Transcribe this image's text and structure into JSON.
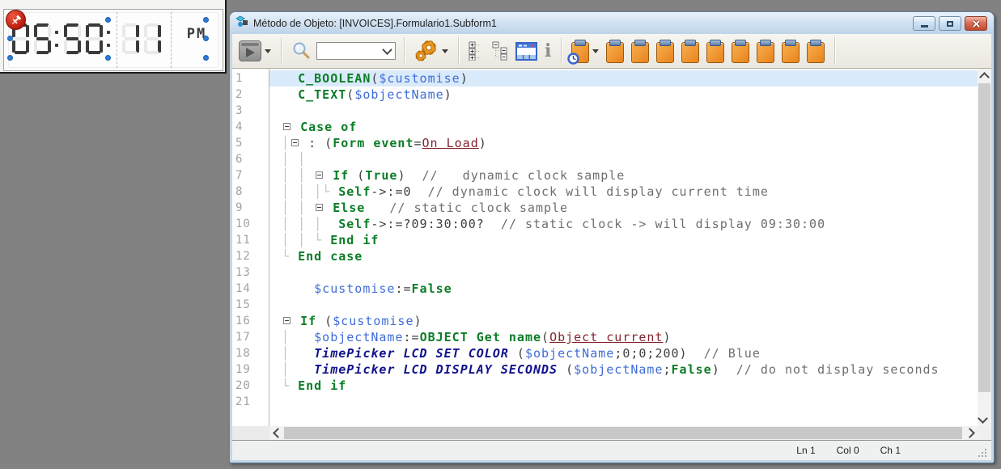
{
  "window": {
    "title": "Método de Objeto: [INVOICES].Formulario1.Subform1"
  },
  "clock": {
    "time_display": "05:50:11",
    "hours": "05",
    "minutes": "50",
    "seconds": "11",
    "period": "PM"
  },
  "toolbar": {
    "search_value": "",
    "icons": [
      "run-method-icon",
      "magnifier-icon",
      "gears-icon",
      "expand-all-icon",
      "collapse-all-icon",
      "form-objects-icon",
      "info-icon",
      "clipboard-clock-icon",
      "clipboard-icon"
    ]
  },
  "status": {
    "line": "Ln 1",
    "column": "Col 0",
    "char": "Ch 1"
  },
  "colors": {
    "keyword_green": "#0b7d26",
    "variable_blue": "#3e6cd8",
    "constant_maroon": "#84242e",
    "plugin_navy": "#10128c",
    "comment_gray": "#6e6e6e",
    "current_line": "#d9eafb",
    "clipboard_orange": "#ef8f2a",
    "lcd_lit": "#3a3a3a",
    "lcd_ghost": "#e9e9e9"
  },
  "editor": {
    "lines": [
      {
        "n": 1,
        "cur": true,
        "t": [
          [
            "o",
            "   "
          ],
          [
            "k",
            "C_BOOLEAN"
          ],
          [
            "o",
            "("
          ],
          [
            "v",
            "$customise"
          ],
          [
            "o",
            ")"
          ]
        ]
      },
      {
        "n": 2,
        "t": [
          [
            "o",
            "   "
          ],
          [
            "k",
            "C_TEXT"
          ],
          [
            "o",
            "("
          ],
          [
            "v",
            "$objectName"
          ],
          [
            "o",
            ")"
          ]
        ]
      },
      {
        "n": 3,
        "t": []
      },
      {
        "n": 4,
        "t": [
          [
            "o",
            " "
          ],
          [
            "f",
            ""
          ],
          [
            "o",
            " "
          ],
          [
            "k",
            "Case of"
          ]
        ]
      },
      {
        "n": 5,
        "t": [
          [
            "o",
            " "
          ],
          [
            "g",
            "│"
          ],
          [
            "f",
            ""
          ],
          [
            "o",
            " "
          ],
          [
            "o",
            ": ("
          ],
          [
            "k",
            "Form event"
          ],
          [
            "o",
            "="
          ],
          [
            "c",
            "On Load"
          ],
          [
            "o",
            ")"
          ]
        ]
      },
      {
        "n": 6,
        "t": [
          [
            "o",
            " "
          ],
          [
            "g",
            "│"
          ],
          [
            "o",
            " "
          ],
          [
            "g",
            "│"
          ]
        ]
      },
      {
        "n": 7,
        "t": [
          [
            "o",
            " "
          ],
          [
            "g",
            "│"
          ],
          [
            "o",
            " "
          ],
          [
            "g",
            "│"
          ],
          [
            "o",
            " "
          ],
          [
            "f",
            ""
          ],
          [
            "o",
            " "
          ],
          [
            "k",
            "If"
          ],
          [
            "o",
            " ("
          ],
          [
            "k",
            "True"
          ],
          [
            "o",
            ")"
          ],
          [
            "m",
            "  //   dynamic clock sample"
          ]
        ]
      },
      {
        "n": 8,
        "t": [
          [
            "o",
            " "
          ],
          [
            "g",
            "│"
          ],
          [
            "o",
            " "
          ],
          [
            "g",
            "│"
          ],
          [
            "o",
            " "
          ],
          [
            "g",
            "│"
          ],
          [
            "g",
            "└"
          ],
          [
            "o",
            " "
          ],
          [
            "k",
            "Self"
          ],
          [
            "o",
            "->:=0"
          ],
          [
            "m",
            "  // dynamic clock will display current time"
          ]
        ]
      },
      {
        "n": 9,
        "t": [
          [
            "o",
            " "
          ],
          [
            "g",
            "│"
          ],
          [
            "o",
            " "
          ],
          [
            "g",
            "│"
          ],
          [
            "o",
            " "
          ],
          [
            "f",
            ""
          ],
          [
            "o",
            " "
          ],
          [
            "k",
            "Else"
          ],
          [
            "m",
            "   // static clock sample"
          ]
        ]
      },
      {
        "n": 10,
        "t": [
          [
            "o",
            " "
          ],
          [
            "g",
            "│"
          ],
          [
            "o",
            " "
          ],
          [
            "g",
            "│"
          ],
          [
            "o",
            " "
          ],
          [
            "g",
            "│"
          ],
          [
            "o",
            "  "
          ],
          [
            "k",
            "Self"
          ],
          [
            "o",
            "->:=?09:30:00?"
          ],
          [
            "m",
            "  // static clock -> will display 09:30:00"
          ]
        ]
      },
      {
        "n": 11,
        "t": [
          [
            "o",
            " "
          ],
          [
            "g",
            "│"
          ],
          [
            "o",
            " "
          ],
          [
            "g",
            "│"
          ],
          [
            "o",
            " "
          ],
          [
            "g",
            "└"
          ],
          [
            "o",
            " "
          ],
          [
            "k",
            "End if"
          ]
        ]
      },
      {
        "n": 12,
        "t": [
          [
            "o",
            " "
          ],
          [
            "g",
            "└"
          ],
          [
            "o",
            " "
          ],
          [
            "k",
            "End case"
          ]
        ]
      },
      {
        "n": 13,
        "t": []
      },
      {
        "n": 14,
        "t": [
          [
            "o",
            "     "
          ],
          [
            "v",
            "$customise"
          ],
          [
            "o",
            ":="
          ],
          [
            "k",
            "False"
          ]
        ]
      },
      {
        "n": 15,
        "t": []
      },
      {
        "n": 16,
        "t": [
          [
            "o",
            " "
          ],
          [
            "f",
            ""
          ],
          [
            "o",
            " "
          ],
          [
            "k",
            "If"
          ],
          [
            "o",
            " ("
          ],
          [
            "v",
            "$customise"
          ],
          [
            "o",
            ")"
          ]
        ]
      },
      {
        "n": 17,
        "t": [
          [
            "o",
            " "
          ],
          [
            "g",
            "│"
          ],
          [
            "o",
            "   "
          ],
          [
            "v",
            "$objectName"
          ],
          [
            "o",
            ":="
          ],
          [
            "k",
            "OBJECT Get name"
          ],
          [
            "o",
            "("
          ],
          [
            "c",
            "Object current"
          ],
          [
            "o",
            ")"
          ]
        ]
      },
      {
        "n": 18,
        "t": [
          [
            "o",
            " "
          ],
          [
            "g",
            "│"
          ],
          [
            "o",
            "   "
          ],
          [
            "p",
            "TimePicker LCD SET COLOR"
          ],
          [
            "o",
            " ("
          ],
          [
            "v",
            "$objectName"
          ],
          [
            "o",
            ";0;0;200)"
          ],
          [
            "m",
            "  // Blue"
          ]
        ]
      },
      {
        "n": 19,
        "t": [
          [
            "o",
            " "
          ],
          [
            "g",
            "│"
          ],
          [
            "o",
            "   "
          ],
          [
            "p",
            "TimePicker LCD DISPLAY SECONDS"
          ],
          [
            "o",
            " ("
          ],
          [
            "v",
            "$objectName"
          ],
          [
            "o",
            ";"
          ],
          [
            "k",
            "False"
          ],
          [
            "o",
            ")"
          ],
          [
            "m",
            "  // do not display seconds"
          ]
        ]
      },
      {
        "n": 20,
        "t": [
          [
            "o",
            " "
          ],
          [
            "g",
            "└"
          ],
          [
            "o",
            " "
          ],
          [
            "k",
            "End if"
          ]
        ]
      },
      {
        "n": 21,
        "t": []
      }
    ]
  }
}
